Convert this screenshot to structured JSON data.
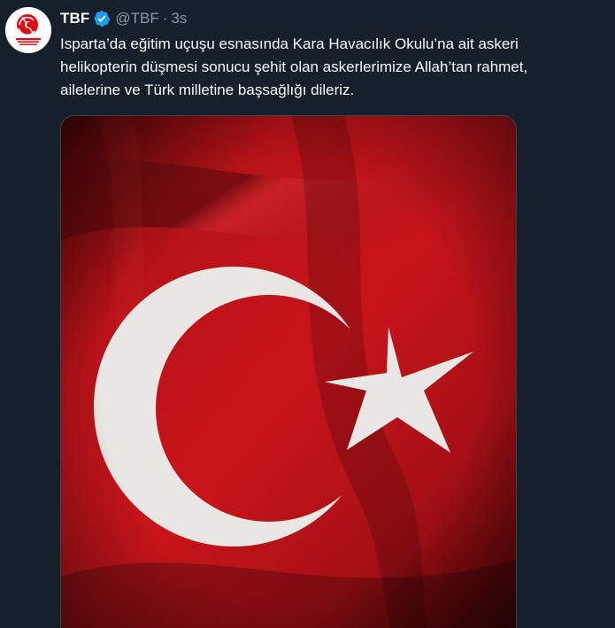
{
  "author": {
    "name": "TBF",
    "handle": "@TBF",
    "separator": "·",
    "time": "3s",
    "verified": true,
    "avatar_icon": "tbf-logo-icon",
    "verified_icon": "verified-badge-icon",
    "logo_text": "TÜRKİYE BASKETBOL FEDERASYONU"
  },
  "tweet": {
    "lines": [
      "Isparta’da eğitim uçuşu esnasında Kara Havacılık Okulu’na ait askeri",
      "helikopterin düşmesi sonucu şehit olan askerlerimize Allah’tan rahmet,",
      "ailelerine ve Türk milletine başsağlığı dileriz."
    ]
  },
  "media": {
    "type": "image",
    "description_icon": "turkish-flag-image"
  },
  "colors": {
    "background": "#15202b",
    "text_primary": "#f7f9f9",
    "text_secondary": "#8b98a5",
    "verified": "#1d9bf0",
    "flag_red": "#c8141b",
    "flag_white": "#e9e6e4"
  }
}
